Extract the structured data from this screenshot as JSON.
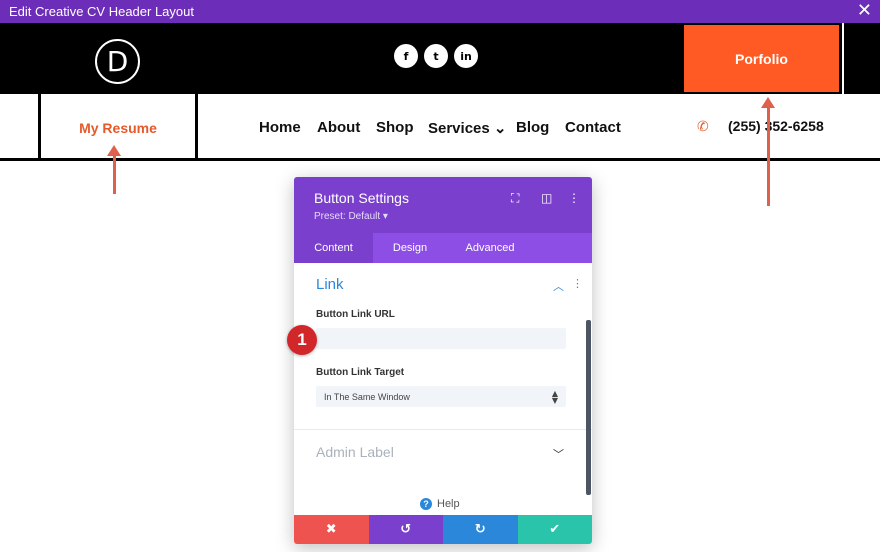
{
  "window": {
    "title": "Edit Creative CV Header Layout",
    "close_glyph": "✕"
  },
  "header": {
    "logo_letter": "D",
    "social": [
      {
        "name": "facebook-icon",
        "glyph": "f"
      },
      {
        "name": "twitter-icon",
        "glyph": "t"
      },
      {
        "name": "linkedin-icon",
        "glyph": "in"
      }
    ],
    "portfolio_button": "Porfolio",
    "resume_button": "My Resume",
    "nav": [
      "Home",
      "About",
      "Shop",
      "Services ⌄",
      "Blog",
      "Contact"
    ],
    "phone": "(255) 352-6258",
    "accent": "#ff5a24"
  },
  "modal": {
    "title": "Button Settings",
    "preset": "Preset: Default ▾",
    "tabs": [
      "Content",
      "Design",
      "Advanced"
    ],
    "active_tab": "Content",
    "section": "Link",
    "url_label": "Button Link URL",
    "url_value": "",
    "target_label": "Button Link Target",
    "target_value": "In The Same Window",
    "admin_label": "Admin Label",
    "help": "Help",
    "footer": [
      "✖",
      "↺",
      "↻",
      "✔"
    ],
    "colors": {
      "header": "#7b3fce",
      "tabs": "#8c4ee4",
      "cancel": "#ef5350",
      "undo": "#7b3fce",
      "redo": "#2b87da",
      "save": "#29c4a9"
    }
  },
  "annotation": {
    "step": "1"
  }
}
